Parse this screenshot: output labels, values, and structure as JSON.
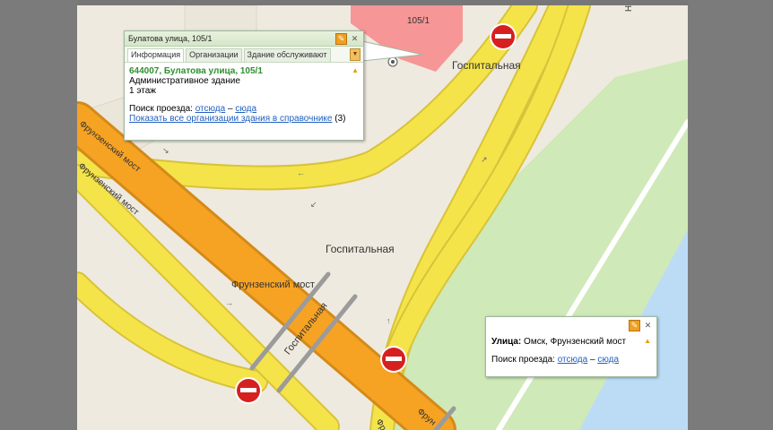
{
  "map": {
    "building_number": "105/1",
    "corner_letter": "Н",
    "street_labels": {
      "gospitalnaya_top": "Госпитальная",
      "gospitalnaya_mid": "Госпитальная",
      "gospitalnaya_bridge": "Госпитальная",
      "frunzensky_most_1": "Фрунзенский мост",
      "frunzensky_most_2": "Фрунзенский мост",
      "frunzensky_most_3": "Фрунзенский мост",
      "frunz_partial_1": "Фрун",
      "frunz_partial_2": "Фр"
    },
    "colors": {
      "background": "#efeadf",
      "road_yellow": "#f4e44a",
      "road_orange": "#f6a323",
      "green_area": "#cfe9b8",
      "water": "#bad8ff",
      "building_pink": "#f79696",
      "no_entry": "#d62020"
    }
  },
  "popup_building": {
    "title": "Булатова улица, 105/1",
    "tabs": [
      "Информация",
      "Организации",
      "Здание обслуживают"
    ],
    "address": "644007, Булатова улица, 105/1",
    "type": "Административное здание",
    "floors": "1 этаж",
    "route_label": "Поиск проезда:",
    "route_from": "отсюда",
    "route_dash": "–",
    "route_to": "сюда",
    "show_orgs_link": "Показать все организации здания в справочнике",
    "orgs_count": "(3)"
  },
  "popup_street": {
    "street_label": "Улица:",
    "street_value": "Омск, Фрунзенский мост",
    "route_label": "Поиск проезда:",
    "route_from": "отсюда",
    "route_dash": "–",
    "route_to": "сюда"
  },
  "icons": {
    "pin": "pin-icon",
    "close": "close-icon",
    "warning": "warning-icon",
    "no_entry": "no-entry-sign-icon",
    "tabs_more": "chevron-down-icon"
  }
}
